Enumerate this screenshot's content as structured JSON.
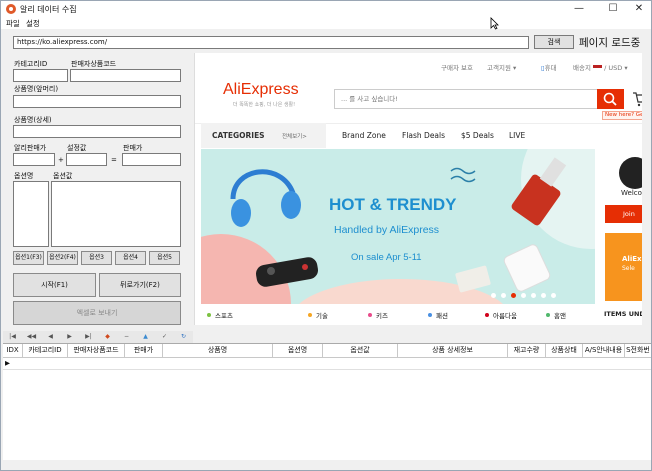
{
  "window": {
    "title": "알리 데이터 수집",
    "minimize_glyph": "—",
    "maximize_glyph": "☐",
    "close_glyph": "✕"
  },
  "menu": {
    "items": [
      "파일",
      "설정"
    ]
  },
  "toolbar": {
    "url_value": "https://ko.aliexpress.com/",
    "search_label": "검색",
    "status_text": "페이지 로드중"
  },
  "form": {
    "category_id_label": "카테고리ID",
    "seller_code_label": "판매자상품코드",
    "product_name_front_label": "상품명(앞머리)",
    "product_name_detail_label": "상품명(상세)",
    "ali_price_label": "알리판매가",
    "setting_value_label": "설정값",
    "sale_price_label": "판매가",
    "plus_sign": "+",
    "equals_sign": "=",
    "option_name_label": "옵션명",
    "option_value_label": "옵션값",
    "option_buttons": [
      "옵션1(F3)",
      "옵션2(F4)",
      "옵션3",
      "옵션4",
      "옵션5"
    ],
    "start_label": "시작(F1)",
    "back_label": "뒤로가기(F2)",
    "excel_label": "엑셀로 보내기"
  },
  "grid": {
    "columns": [
      "IDX",
      "카테고리ID",
      "판매자상품코드",
      "판매가",
      "상품명",
      "옵션명",
      "옵션값",
      "상품 상세정보",
      "재고수량",
      "상품상태",
      "A/S안내내용",
      "S전화번"
    ],
    "row_indicator": "▶"
  },
  "browser": {
    "top_links": [
      "구매자 보호",
      "고객지원 ▾",
      "휴대",
      "배송지",
      "/ USD ▾"
    ],
    "logo_text": "AliExpress",
    "logo_tagline": "더 똑똑한 쇼핑, 더 나은 생활!",
    "search_placeholder": "... 를 사고 싶습니다!",
    "new_here": "New here? Get",
    "categories_label": "CATEGORIES",
    "categories_all": "전체보기>",
    "nav_links": [
      "Brand Zone",
      "Flash Deals",
      "$5 Deals",
      "LIVE"
    ],
    "banner_title": "HOT & TRENDY",
    "banner_sub": "Handled by AliExpress",
    "banner_date": "On sale Apr 5-11",
    "welcome": "Welcome",
    "join": "Join",
    "side_promo": "AliExp",
    "side_promo2": "Sele",
    "cat_tabs": [
      "스포츠",
      "기술",
      "키즈",
      "패션",
      "아름다움",
      "홈앤"
    ],
    "cat_tab_colors": [
      "#7cc242",
      "#f5a623",
      "#e84c8b",
      "#4a90e2",
      "#d0021b",
      "#50b86c"
    ],
    "items_under": "ITEMS UNDEF"
  },
  "colors": {
    "accent": "#e62e04",
    "banner_teal": "#c9ece8",
    "banner_blue": "#1e8fcf"
  }
}
